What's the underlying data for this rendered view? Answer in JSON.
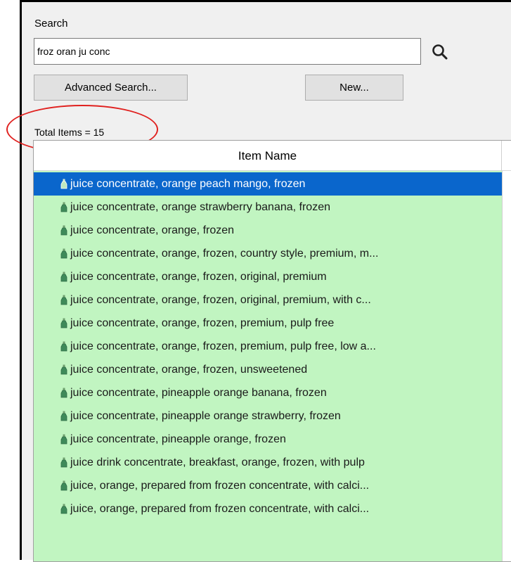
{
  "search": {
    "label": "Search",
    "value": "froz oran ju conc",
    "icon": "magnifier-icon"
  },
  "buttons": {
    "advanced_search": "Advanced Search...",
    "new": "New..."
  },
  "total_items_text": "Total Items = 15",
  "list": {
    "column_header": "Item Name",
    "row_icon": "bottle-icon",
    "row_color": "#c1f5c1",
    "selected_color": "#0a66cc",
    "selected_index": 0,
    "items": [
      "juice concentrate, orange peach mango, frozen",
      "juice concentrate, orange strawberry banana, frozen",
      "juice concentrate, orange, frozen",
      "juice concentrate, orange, frozen, country style, premium, m...",
      "juice concentrate, orange, frozen, original, premium",
      "juice concentrate, orange, frozen, original, premium, with c...",
      "juice concentrate, orange, frozen, premium, pulp free",
      "juice concentrate, orange, frozen, premium, pulp free, low a...",
      "juice concentrate, orange, frozen, unsweetened",
      "juice concentrate, pineapple orange banana, frozen",
      "juice concentrate, pineapple orange strawberry, frozen",
      "juice concentrate, pineapple orange, frozen",
      "juice drink concentrate, breakfast, orange, frozen, with pulp",
      "juice, orange, prepared from frozen concentrate, with calci...",
      "juice, orange, prepared from frozen concentrate, with calci..."
    ]
  },
  "annotation_color": "#e0211f"
}
